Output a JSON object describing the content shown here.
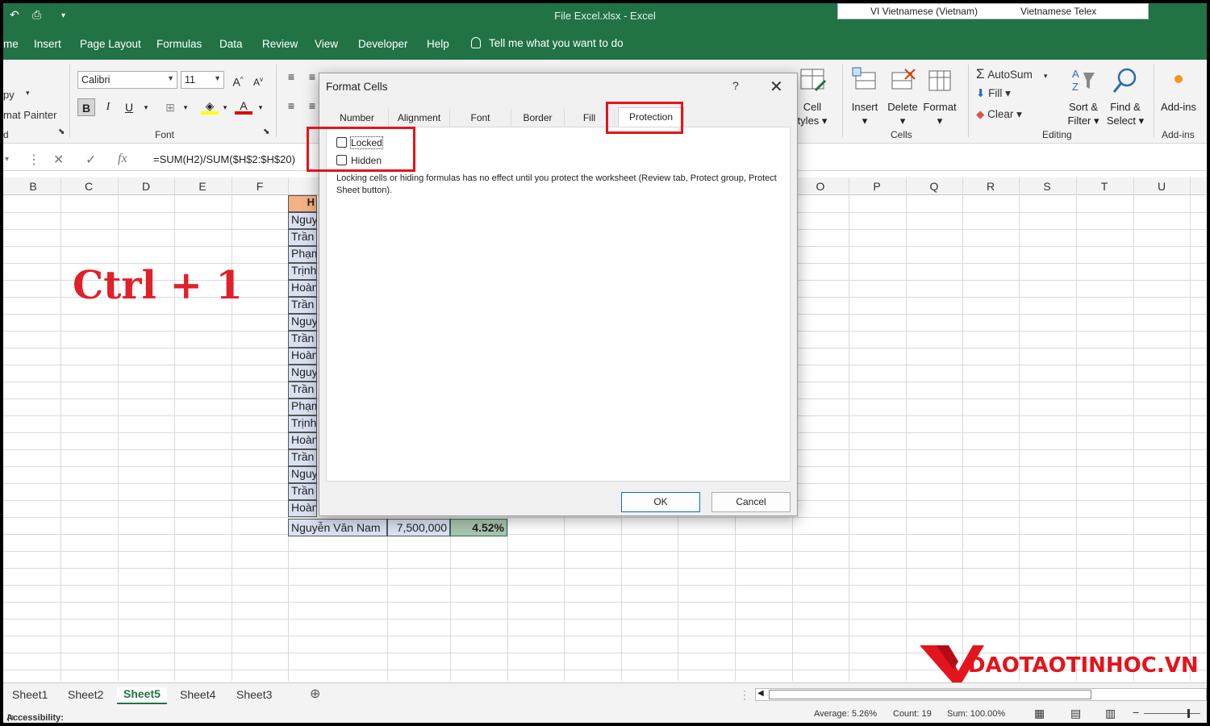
{
  "window": {
    "title": "File Excel.xlsx  -  Excel"
  },
  "ime": {
    "language": "VI  Vietnamese (Vietnam)",
    "keyboard": "Vietnamese Telex"
  },
  "ribbon_tabs": [
    "me",
    "Insert",
    "Page Layout",
    "Formulas",
    "Data",
    "Review",
    "View",
    "Developer",
    "Help"
  ],
  "tell_me": "Tell me what you want to do",
  "clipboard": {
    "copy": "py",
    "painter": "mat Painter",
    "group_label": "d"
  },
  "font": {
    "name": "Calibri",
    "size": "11",
    "group_label": "Font",
    "bold": "B",
    "italic": "I",
    "underline": "U"
  },
  "cells_group": {
    "cell_styles": [
      "Cell",
      "tyles"
    ],
    "insert": "Insert",
    "delete": "Delete",
    "format": "Format",
    "group_label": "Cells"
  },
  "editing_group": {
    "autosum": "AutoSum",
    "fill": "Fill",
    "clear": "Clear",
    "sort": [
      "Sort &",
      "Filter"
    ],
    "find": [
      "Find &",
      "Select"
    ],
    "group_label": "Editing"
  },
  "addins_group": {
    "label": "Add-ins",
    "group_label": "Add-ins"
  },
  "formula_bar": {
    "fx": "fx",
    "formula": "=SUM(H2)/SUM($H$2:$H$20)"
  },
  "columns": [
    "B",
    "C",
    "D",
    "E",
    "F",
    "O",
    "P",
    "Q",
    "R",
    "S",
    "T",
    "U"
  ],
  "header_cell": "H",
  "name_cells": [
    "Nguyễ",
    "Trần I",
    "Phạm",
    "Trịnh",
    "Hoàn",
    "Trần t",
    "Nguyễ",
    "Trần I",
    "Hoàn",
    "Nguyễ",
    "Trần I",
    "Phạm",
    "Trịnh",
    "Hoàn",
    "Trần t",
    "Nguyễ",
    "Trần I",
    "Hoàn"
  ],
  "last_row": {
    "name": "Nguyễn Văn Nam",
    "amount": "7,500,000",
    "percent": "4.52%"
  },
  "hint": "Ctrl + 1",
  "dialog": {
    "title": "Format Cells",
    "help": "?",
    "close": "✕",
    "tabs": [
      "Number",
      "Alignment",
      "Font",
      "Border",
      "Fill",
      "Protection"
    ],
    "active_tab": "Protection",
    "locked_label": "Locked",
    "hidden_label": "Hidden",
    "locked": false,
    "hidden": false,
    "note": "Locking cells or hiding formulas has no effect until you protect the worksheet (Review tab, Protect group, Protect Sheet button).",
    "ok": "OK",
    "cancel": "Cancel"
  },
  "sheets": [
    "Sheet1",
    "Sheet2",
    "Sheet5",
    "Sheet4",
    "Sheet3"
  ],
  "active_sheet": "Sheet5",
  "status": {
    "accessibility": "Accessibility: Investigate",
    "average": "Average: 5.26%",
    "count": "Count: 19",
    "sum": "Sum: 100.00%"
  },
  "brand": "DAOTAOTINHOC.VN",
  "colors": {
    "excel_green": "#217346",
    "highlight_red": "#e3141c",
    "hint_red": "#e0202a"
  }
}
